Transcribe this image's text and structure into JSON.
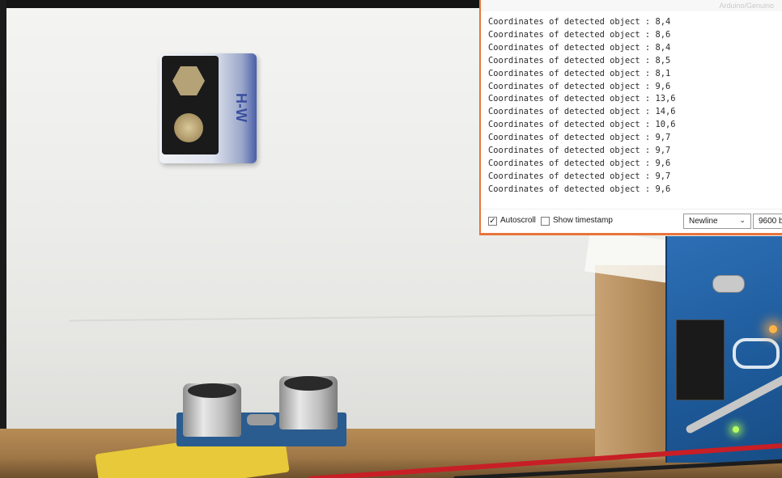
{
  "serial_monitor": {
    "title_text": "Arduino/Genuino",
    "lines": [
      "Coordinates of detected object : 8,4",
      "Coordinates of detected object : 8,6",
      "Coordinates of detected object : 8,4",
      "Coordinates of detected object : 8,5",
      "Coordinates of detected object : 8,1",
      "Coordinates of detected object : 9,6",
      "Coordinates of detected object : 13,6",
      "Coordinates of detected object : 14,6",
      "Coordinates of detected object : 10,6",
      "Coordinates of detected object : 9,7",
      "Coordinates of detected object : 9,7",
      "Coordinates of detected object : 9,6",
      "Coordinates of detected object : 9,7",
      "Coordinates of detected object : 9,6"
    ],
    "autoscroll": {
      "label": "Autoscroll",
      "checked": true,
      "mark": "✓"
    },
    "show_timestamp": {
      "label": "Show timestamp",
      "checked": false
    },
    "line_ending": {
      "selected": "Newline"
    },
    "baud_rate": {
      "selected": "9600 ba"
    }
  },
  "scene": {
    "battery_label": "H-W",
    "accent_color": "#e8743b"
  }
}
